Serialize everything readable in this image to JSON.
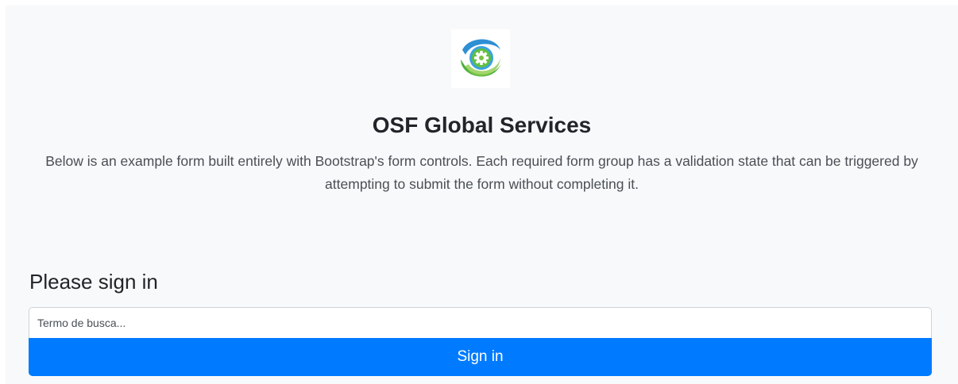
{
  "header": {
    "title": "OSF Global Services",
    "description": "Below is an example form built entirely with Bootstrap's form controls. Each required form group has a validation state that can be triggered by attempting to submit the form without completing it."
  },
  "logo": {
    "icon": "gear-globe-logo-icon",
    "colors": {
      "green": "#5fb83c",
      "blue": "#2e8fd4",
      "gear": "#7ac142"
    }
  },
  "form": {
    "heading": "Please sign in",
    "search_placeholder": "Termo de busca...",
    "search_value": "",
    "submit_label": "Sign in"
  },
  "colors": {
    "background": "#f8f9fa",
    "primary": "#007bff",
    "text": "#212529"
  }
}
